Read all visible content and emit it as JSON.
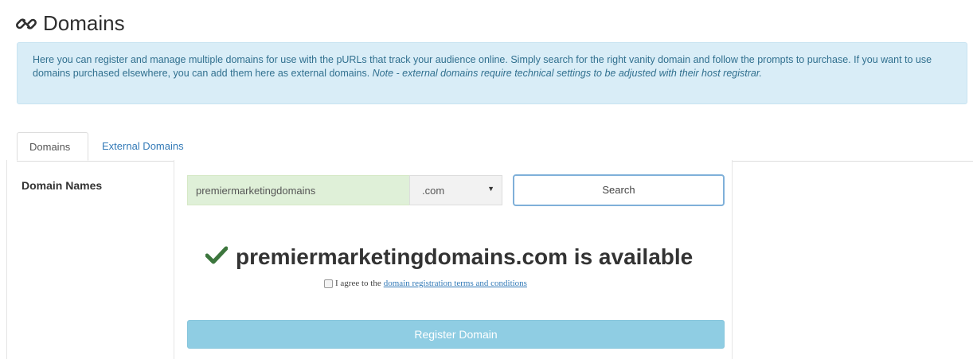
{
  "header": {
    "icon": "link-icon",
    "title": "Domains"
  },
  "info": {
    "text": "Here you can register and manage multiple domains for use with the pURLs that track your audience online. Simply search for the right vanity domain and follow the prompts to purchase. If you want to use domains purchased elsewhere, you can add them here as external domains. ",
    "note": "Note - external domains require technical settings to be adjusted with their host registrar."
  },
  "tabs": [
    {
      "label": "Domains",
      "active": true
    },
    {
      "label": "External Domains",
      "active": false
    }
  ],
  "form": {
    "label": "Domain Names",
    "domain_value": "premiermarketingdomains",
    "tld_selected": ".com",
    "search_label": "Search"
  },
  "result": {
    "icon": "checkmark-icon",
    "message": "premiermarketingdomains.com is available",
    "status_color": "#3c763d"
  },
  "terms": {
    "prefix": "I agree to the",
    "link_text": "domain registration terms and conditions",
    "checked": false
  },
  "register": {
    "label": "Register Domain"
  },
  "colors": {
    "info_bg": "#d9edf7",
    "info_text": "#31708f",
    "input_bg": "#dff0d8",
    "register_bg": "#8fcde3",
    "link": "#337ab7"
  }
}
